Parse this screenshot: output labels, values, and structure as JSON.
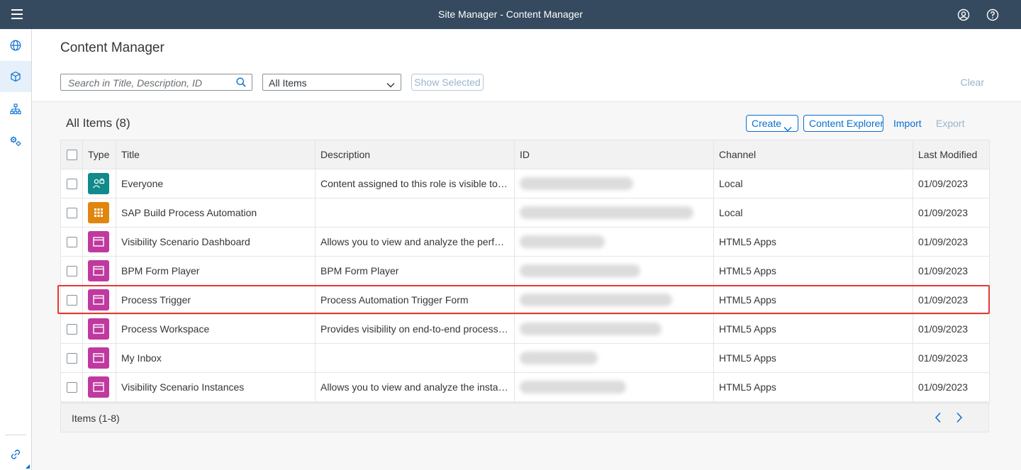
{
  "shell": {
    "title": "Site Manager - Content Manager"
  },
  "page": {
    "title": "Content Manager"
  },
  "filters": {
    "search_placeholder": "Search in Title, Description, ID",
    "select_value": "All Items",
    "show_selected_label": "Show Selected",
    "clear_label": "Clear"
  },
  "toolbar": {
    "count_label": "All Items (8)",
    "create_label": "Create",
    "content_explorer_label": "Content Explorer",
    "import_label": "Import",
    "export_label": "Export"
  },
  "table": {
    "columns": [
      "Type",
      "Title",
      "Description",
      "ID",
      "Channel",
      "Last Modified"
    ],
    "rows": [
      {
        "type_icon": "role-icon",
        "type_color": "#108a8a",
        "title": "Everyone",
        "description": "Content assigned to this role is visible to all ...",
        "channel": "Local",
        "modified": "01/09/2023"
      },
      {
        "type_icon": "app-grid-icon",
        "type_color": "#e0860f",
        "title": "SAP Build Process Automation",
        "description": "",
        "channel": "Local",
        "modified": "01/09/2023"
      },
      {
        "type_icon": "app-window-icon",
        "type_color": "#c0399f",
        "title": "Visibility Scenario Dashboard",
        "description": "Allows you to view and analyze the perform...",
        "channel": "HTML5 Apps",
        "modified": "01/09/2023"
      },
      {
        "type_icon": "app-window-icon",
        "type_color": "#c0399f",
        "title": "BPM Form Player",
        "description": "BPM Form Player",
        "channel": "HTML5 Apps",
        "modified": "01/09/2023"
      },
      {
        "type_icon": "app-window-icon",
        "type_color": "#c0399f",
        "title": "Process Trigger",
        "description": "Process Automation Trigger Form",
        "channel": "HTML5 Apps",
        "modified": "01/09/2023"
      },
      {
        "type_icon": "app-window-icon",
        "type_color": "#c0399f",
        "title": "Process Workspace",
        "description": "Provides visibility on end-to-end processes ...",
        "channel": "HTML5 Apps",
        "modified": "01/09/2023"
      },
      {
        "type_icon": "app-window-icon",
        "type_color": "#c0399f",
        "title": "My Inbox",
        "description": "",
        "channel": "HTML5 Apps",
        "modified": "01/09/2023"
      },
      {
        "type_icon": "app-window-icon",
        "type_color": "#c0399f",
        "title": "Visibility Scenario Instances",
        "description": "Allows you to view and analyze the instanc...",
        "channel": "HTML5 Apps",
        "modified": "01/09/2023"
      }
    ]
  },
  "footer": {
    "items_label": "Items (1-8)"
  },
  "colors": {
    "shell_bg": "#354a5f",
    "accent": "#0a6ed1",
    "highlight": "#e53935"
  }
}
